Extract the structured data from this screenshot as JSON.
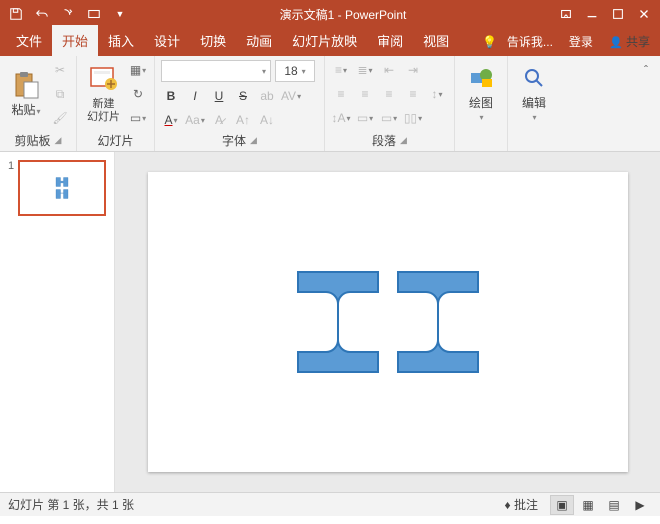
{
  "titlebar": {
    "title": "演示文稿1 - PowerPoint"
  },
  "tabs": {
    "file": "文件",
    "home": "开始",
    "insert": "插入",
    "design": "设计",
    "transition": "切换",
    "animation": "动画",
    "slideshow": "幻灯片放映",
    "review": "审阅",
    "view": "视图",
    "tell": "告诉我...",
    "login": "登录",
    "share": "共享"
  },
  "ribbon": {
    "clipboard": {
      "paste": "粘贴",
      "label": "剪贴板"
    },
    "slides": {
      "new": "新建\n幻灯片",
      "label": "幻灯片"
    },
    "font": {
      "size": "18",
      "label": "字体"
    },
    "para": {
      "label": "段落"
    },
    "draw": {
      "btn": "绘图",
      "label": ""
    },
    "edit": {
      "btn": "编辑",
      "label": ""
    }
  },
  "thumb": {
    "num": "1"
  },
  "status": {
    "slide": "幻灯片 第 1 张，共 1 张",
    "comments": "批注"
  }
}
